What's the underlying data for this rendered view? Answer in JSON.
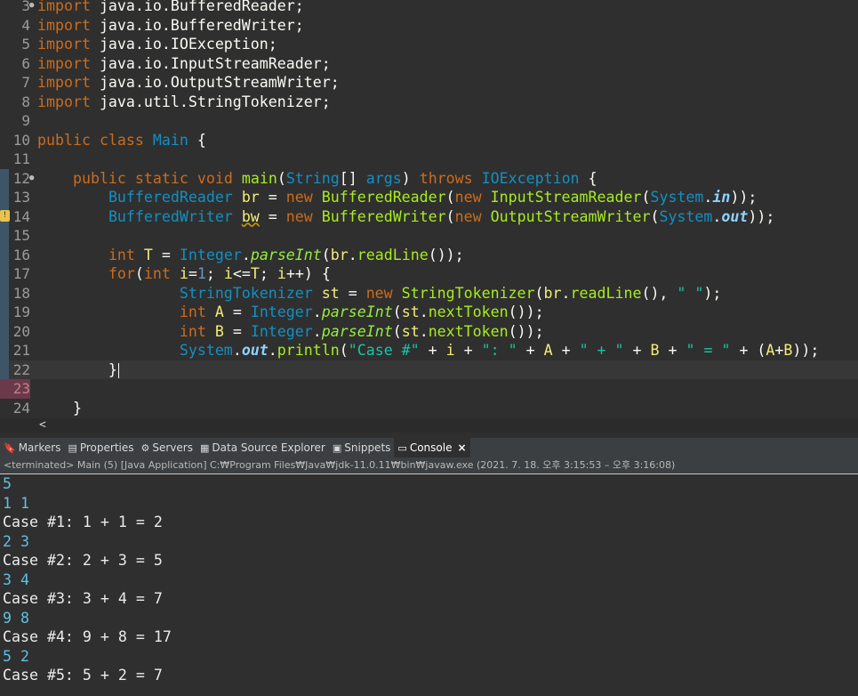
{
  "editor": {
    "lines": [
      {
        "num": "3",
        "fold": true,
        "tokens": [
          [
            "kw",
            "import"
          ],
          [
            "plain",
            " java.io.BufferedReader;"
          ]
        ]
      },
      {
        "num": "4",
        "tokens": [
          [
            "kw",
            "import"
          ],
          [
            "plain",
            " java.io.BufferedWriter;"
          ]
        ]
      },
      {
        "num": "5",
        "tokens": [
          [
            "kw",
            "import"
          ],
          [
            "plain",
            " java.io.IOException;"
          ]
        ]
      },
      {
        "num": "6",
        "tokens": [
          [
            "kw",
            "import"
          ],
          [
            "plain",
            " java.io.InputStreamReader;"
          ]
        ]
      },
      {
        "num": "7",
        "tokens": [
          [
            "kw",
            "import"
          ],
          [
            "plain",
            " java.io.OutputStreamWriter;"
          ]
        ]
      },
      {
        "num": "8",
        "tokens": [
          [
            "kw",
            "import"
          ],
          [
            "plain",
            " java.util.StringTokenizer;"
          ]
        ]
      },
      {
        "num": "9",
        "tokens": []
      },
      {
        "num": "10",
        "tokens": [
          [
            "kw",
            "public"
          ],
          [
            "plain",
            " "
          ],
          [
            "kw",
            "class"
          ],
          [
            "plain",
            " "
          ],
          [
            "cls",
            "Main"
          ],
          [
            "plain",
            " {"
          ]
        ]
      },
      {
        "num": "11",
        "tokens": []
      },
      {
        "num": "12",
        "fold": true,
        "tokens": [
          [
            "plain",
            "    "
          ],
          [
            "kw",
            "public"
          ],
          [
            "plain",
            " "
          ],
          [
            "kw",
            "static"
          ],
          [
            "plain",
            " "
          ],
          [
            "kw",
            "void"
          ],
          [
            "plain",
            " "
          ],
          [
            "fn",
            "main"
          ],
          [
            "plain",
            "("
          ],
          [
            "cls",
            "String"
          ],
          [
            "plain",
            "[] "
          ],
          [
            "ty",
            "args"
          ],
          [
            "plain",
            ") "
          ],
          [
            "kw",
            "throws"
          ],
          [
            "plain",
            " "
          ],
          [
            "cls",
            "IOException"
          ],
          [
            "plain",
            " {"
          ]
        ]
      },
      {
        "num": "13",
        "tokens": [
          [
            "plain",
            "        "
          ],
          [
            "cls",
            "BufferedReader"
          ],
          [
            "plain",
            " "
          ],
          [
            "var",
            "br"
          ],
          [
            "plain",
            " = "
          ],
          [
            "kw",
            "new"
          ],
          [
            "plain",
            " "
          ],
          [
            "fn",
            "BufferedReader"
          ],
          [
            "plain",
            "("
          ],
          [
            "kw",
            "new"
          ],
          [
            "plain",
            " "
          ],
          [
            "fn",
            "InputStreamReader"
          ],
          [
            "plain",
            "("
          ],
          [
            "cls",
            "System"
          ],
          [
            "plain",
            "."
          ],
          [
            "field",
            "in"
          ],
          [
            "plain",
            "));"
          ]
        ]
      },
      {
        "num": "14",
        "warn": true,
        "tokens": [
          [
            "plain",
            "        "
          ],
          [
            "cls",
            "BufferedWriter"
          ],
          [
            "plain",
            " "
          ],
          [
            "var sq",
            "bw"
          ],
          [
            "plain",
            " = "
          ],
          [
            "kw",
            "new"
          ],
          [
            "plain",
            " "
          ],
          [
            "fn",
            "BufferedWriter"
          ],
          [
            "plain",
            "("
          ],
          [
            "kw",
            "new"
          ],
          [
            "plain",
            " "
          ],
          [
            "fn",
            "OutputStreamWriter"
          ],
          [
            "plain",
            "("
          ],
          [
            "cls",
            "System"
          ],
          [
            "plain",
            "."
          ],
          [
            "field",
            "out"
          ],
          [
            "plain",
            "));"
          ]
        ]
      },
      {
        "num": "15",
        "tokens": []
      },
      {
        "num": "16",
        "tokens": [
          [
            "plain",
            "        "
          ],
          [
            "kw",
            "int"
          ],
          [
            "plain",
            " "
          ],
          [
            "var",
            "T"
          ],
          [
            "plain",
            " = "
          ],
          [
            "cls",
            "Integer"
          ],
          [
            "plain",
            "."
          ],
          [
            "static",
            "parseInt"
          ],
          [
            "plain",
            "("
          ],
          [
            "var",
            "br"
          ],
          [
            "plain",
            "."
          ],
          [
            "fn",
            "readLine"
          ],
          [
            "plain",
            "());"
          ]
        ]
      },
      {
        "num": "17",
        "tokens": [
          [
            "plain",
            "        "
          ],
          [
            "kw",
            "for"
          ],
          [
            "plain",
            "("
          ],
          [
            "kw",
            "int"
          ],
          [
            "plain",
            " "
          ],
          [
            "var",
            "i"
          ],
          [
            "plain",
            "="
          ],
          [
            "num",
            "1"
          ],
          [
            "plain",
            "; "
          ],
          [
            "var",
            "i"
          ],
          [
            "plain",
            "<="
          ],
          [
            "var",
            "T"
          ],
          [
            "plain",
            "; "
          ],
          [
            "var",
            "i"
          ],
          [
            "plain",
            "++) {"
          ]
        ]
      },
      {
        "num": "18",
        "tokens": [
          [
            "plain",
            "                "
          ],
          [
            "cls",
            "StringTokenizer"
          ],
          [
            "plain",
            " "
          ],
          [
            "var",
            "st"
          ],
          [
            "plain",
            " = "
          ],
          [
            "kw",
            "new"
          ],
          [
            "plain",
            " "
          ],
          [
            "fn",
            "StringTokenizer"
          ],
          [
            "plain",
            "("
          ],
          [
            "var",
            "br"
          ],
          [
            "plain",
            "."
          ],
          [
            "fn",
            "readLine"
          ],
          [
            "plain",
            "(), "
          ],
          [
            "str",
            "\" \""
          ],
          [
            "plain",
            ");"
          ]
        ]
      },
      {
        "num": "19",
        "tokens": [
          [
            "plain",
            "                "
          ],
          [
            "kw",
            "int"
          ],
          [
            "plain",
            " "
          ],
          [
            "var",
            "A"
          ],
          [
            "plain",
            " = "
          ],
          [
            "cls",
            "Integer"
          ],
          [
            "plain",
            "."
          ],
          [
            "static",
            "parseInt"
          ],
          [
            "plain",
            "("
          ],
          [
            "var",
            "st"
          ],
          [
            "plain",
            "."
          ],
          [
            "fn",
            "nextToken"
          ],
          [
            "plain",
            "());"
          ]
        ]
      },
      {
        "num": "20",
        "tokens": [
          [
            "plain",
            "                "
          ],
          [
            "kw",
            "int"
          ],
          [
            "plain",
            " "
          ],
          [
            "var",
            "B"
          ],
          [
            "plain",
            " = "
          ],
          [
            "cls",
            "Integer"
          ],
          [
            "plain",
            "."
          ],
          [
            "static",
            "parseInt"
          ],
          [
            "plain",
            "("
          ],
          [
            "var",
            "st"
          ],
          [
            "plain",
            "."
          ],
          [
            "fn",
            "nextToken"
          ],
          [
            "plain",
            "());"
          ]
        ]
      },
      {
        "num": "21",
        "tokens": [
          [
            "plain",
            "                "
          ],
          [
            "cls",
            "System"
          ],
          [
            "plain",
            "."
          ],
          [
            "field",
            "out"
          ],
          [
            "plain",
            "."
          ],
          [
            "fn",
            "println"
          ],
          [
            "plain",
            "("
          ],
          [
            "str",
            "\"Case #\""
          ],
          [
            "plain",
            " + "
          ],
          [
            "var",
            "i"
          ],
          [
            "plain",
            " + "
          ],
          [
            "str",
            "\": \""
          ],
          [
            "plain",
            " + "
          ],
          [
            "var",
            "A"
          ],
          [
            "plain",
            " + "
          ],
          [
            "str",
            "\" + \""
          ],
          [
            "plain",
            " + "
          ],
          [
            "var",
            "B"
          ],
          [
            "plain",
            " + "
          ],
          [
            "str",
            "\" = \""
          ],
          [
            "plain",
            " + ("
          ],
          [
            "var",
            "A"
          ],
          [
            "plain",
            "+"
          ],
          [
            "var",
            "B"
          ],
          [
            "plain",
            "));"
          ]
        ]
      },
      {
        "num": "22",
        "current": true,
        "tokens": [
          [
            "plain",
            "        }"
          ]
        ]
      },
      {
        "num": "23",
        "bp": true,
        "tokens": []
      },
      {
        "num": "24",
        "tokens": [
          [
            "plain",
            "    }"
          ]
        ]
      }
    ],
    "scroll_left_arrow": "<"
  },
  "tabs": [
    {
      "label": "Markers",
      "icon": "markers-icon",
      "glyph": "🔖",
      "active": false
    },
    {
      "label": "Properties",
      "icon": "properties-icon",
      "glyph": "▤",
      "active": false
    },
    {
      "label": "Servers",
      "icon": "servers-icon",
      "glyph": "⚙",
      "active": false
    },
    {
      "label": "Data Source Explorer",
      "icon": "datasource-icon",
      "glyph": "▦",
      "active": false
    },
    {
      "label": "Snippets",
      "icon": "snippets-icon",
      "glyph": "▣",
      "active": false
    },
    {
      "label": "Console",
      "icon": "console-icon",
      "glyph": "▭",
      "active": true,
      "close": "×"
    }
  ],
  "console": {
    "status": "<terminated> Main (5) [Java Application] C:₩Program Files₩Java₩jdk-11.0.11₩bin₩javaw.exe  (2021. 7. 18. 오후 3:15:53 – 오후 3:16:08)",
    "lines": [
      {
        "text": "5",
        "kind": "in"
      },
      {
        "text": "1 1",
        "kind": "in"
      },
      {
        "text": "Case #1: 1 + 1 = 2",
        "kind": "out"
      },
      {
        "text": "2 3",
        "kind": "in"
      },
      {
        "text": "Case #2: 2 + 3 = 5",
        "kind": "out"
      },
      {
        "text": "3 4",
        "kind": "in"
      },
      {
        "text": "Case #3: 3 + 4 = 7",
        "kind": "out"
      },
      {
        "text": "9 8",
        "kind": "in"
      },
      {
        "text": "Case #4: 9 + 8 = 17",
        "kind": "out"
      },
      {
        "text": "5 2",
        "kind": "in"
      },
      {
        "text": "Case #5: 5 + 2 = 7",
        "kind": "out"
      }
    ]
  }
}
